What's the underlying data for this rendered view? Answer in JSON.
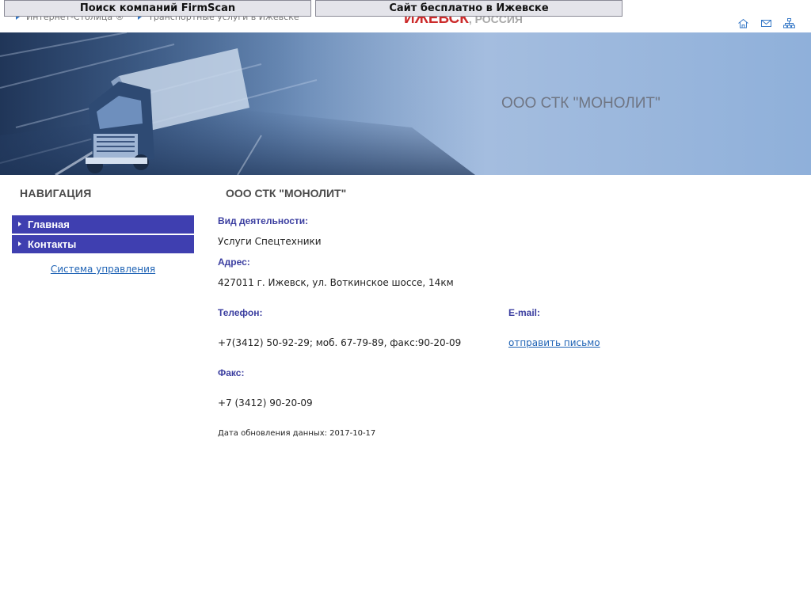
{
  "header": {
    "breadcrumbs": [
      "Интернет-Столица ®",
      "Транспортные услуги в Ижевске"
    ],
    "city": "ИЖЕВСК",
    "country": ", РОССИЯ",
    "icons": [
      "home-icon",
      "mail-icon",
      "sitemap-icon"
    ]
  },
  "overlay": {
    "firmscan_label": "Поиск компаний FirmScan",
    "free_site_label": "Сайт бесплатно в Ижевске"
  },
  "banner": {
    "company_title": "ООО СТК \"МОНОЛИТ\""
  },
  "sidebar": {
    "heading": "НАВИГАЦИЯ",
    "items": [
      {
        "label": "Главная"
      },
      {
        "label": "Контакты"
      }
    ],
    "admin_link": "Система управления"
  },
  "main": {
    "title": "ООО СТК \"МОНОЛИТ\"",
    "activity_label": "Вид деятельности:",
    "activity_value": "Услуги Спецтехники",
    "address_label": "Адрес:",
    "address_value": "427011 г. Ижевск, ул. Воткинское шоссе, 14км",
    "phone_label": "Телефон:",
    "phone_value": "+7(3412) 50-92-29; моб. 67-79-89, факс:90-20-09",
    "email_label": "E-mail:",
    "email_link": "отправить письмо",
    "fax_label": "Факс:",
    "fax_value": "+7 (3412) 90-20-09",
    "updated": "Дата обновления данных: 2017-10-17"
  },
  "colors": {
    "nav_bg": "#3f3fb0",
    "label_blue": "#3b3ea0",
    "link": "#1f63b5",
    "city_red": "#cc2b2b"
  }
}
